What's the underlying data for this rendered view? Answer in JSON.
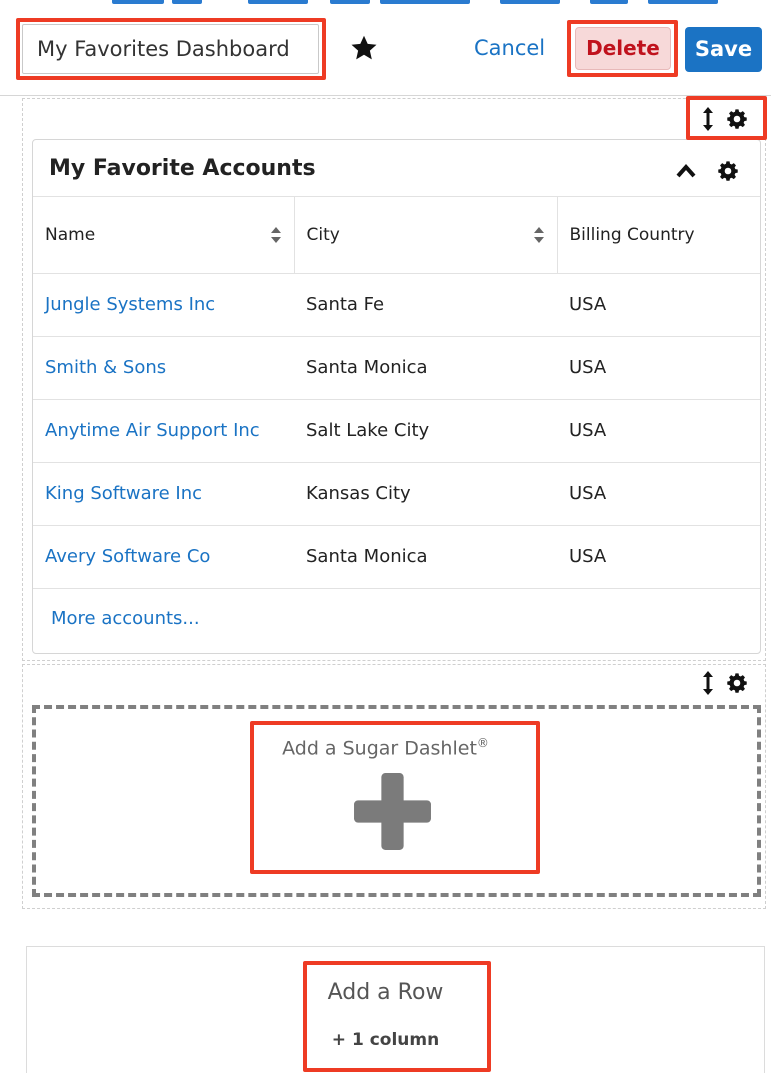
{
  "header": {
    "dashboard_name": "My Favorites Dashboard",
    "cancel_label": "Cancel",
    "delete_label": "Delete",
    "save_label": "Save"
  },
  "dashlet": {
    "title": "My Favorite Accounts",
    "columns": [
      "Name",
      "City",
      "Billing Country"
    ],
    "rows": [
      {
        "name": "Jungle Systems Inc",
        "city": "Santa Fe",
        "country": "USA"
      },
      {
        "name": "Smith & Sons",
        "city": "Santa Monica",
        "country": "USA"
      },
      {
        "name": "Anytime Air Support Inc",
        "city": "Salt Lake City",
        "country": "USA"
      },
      {
        "name": "King Software Inc",
        "city": "Kansas City",
        "country": "USA"
      },
      {
        "name": "Avery Software Co",
        "city": "Santa Monica",
        "country": "USA"
      }
    ],
    "more_link": "More accounts..."
  },
  "add_dashlet": {
    "label": "Add a Sugar Dashlet",
    "mark": "®"
  },
  "add_row": {
    "label": "Add a Row",
    "columns_label": "+ 1 column"
  },
  "colors": {
    "link": "#1a73c4",
    "save": "#1b73c4",
    "delete_text": "#c0121d",
    "delete_bg": "#f7d9d9",
    "callout": "#ee3b24"
  },
  "icons": [
    "star-icon",
    "resize-icon",
    "gear-icon",
    "chevron-up-icon",
    "sort-icon",
    "plus-icon"
  ]
}
